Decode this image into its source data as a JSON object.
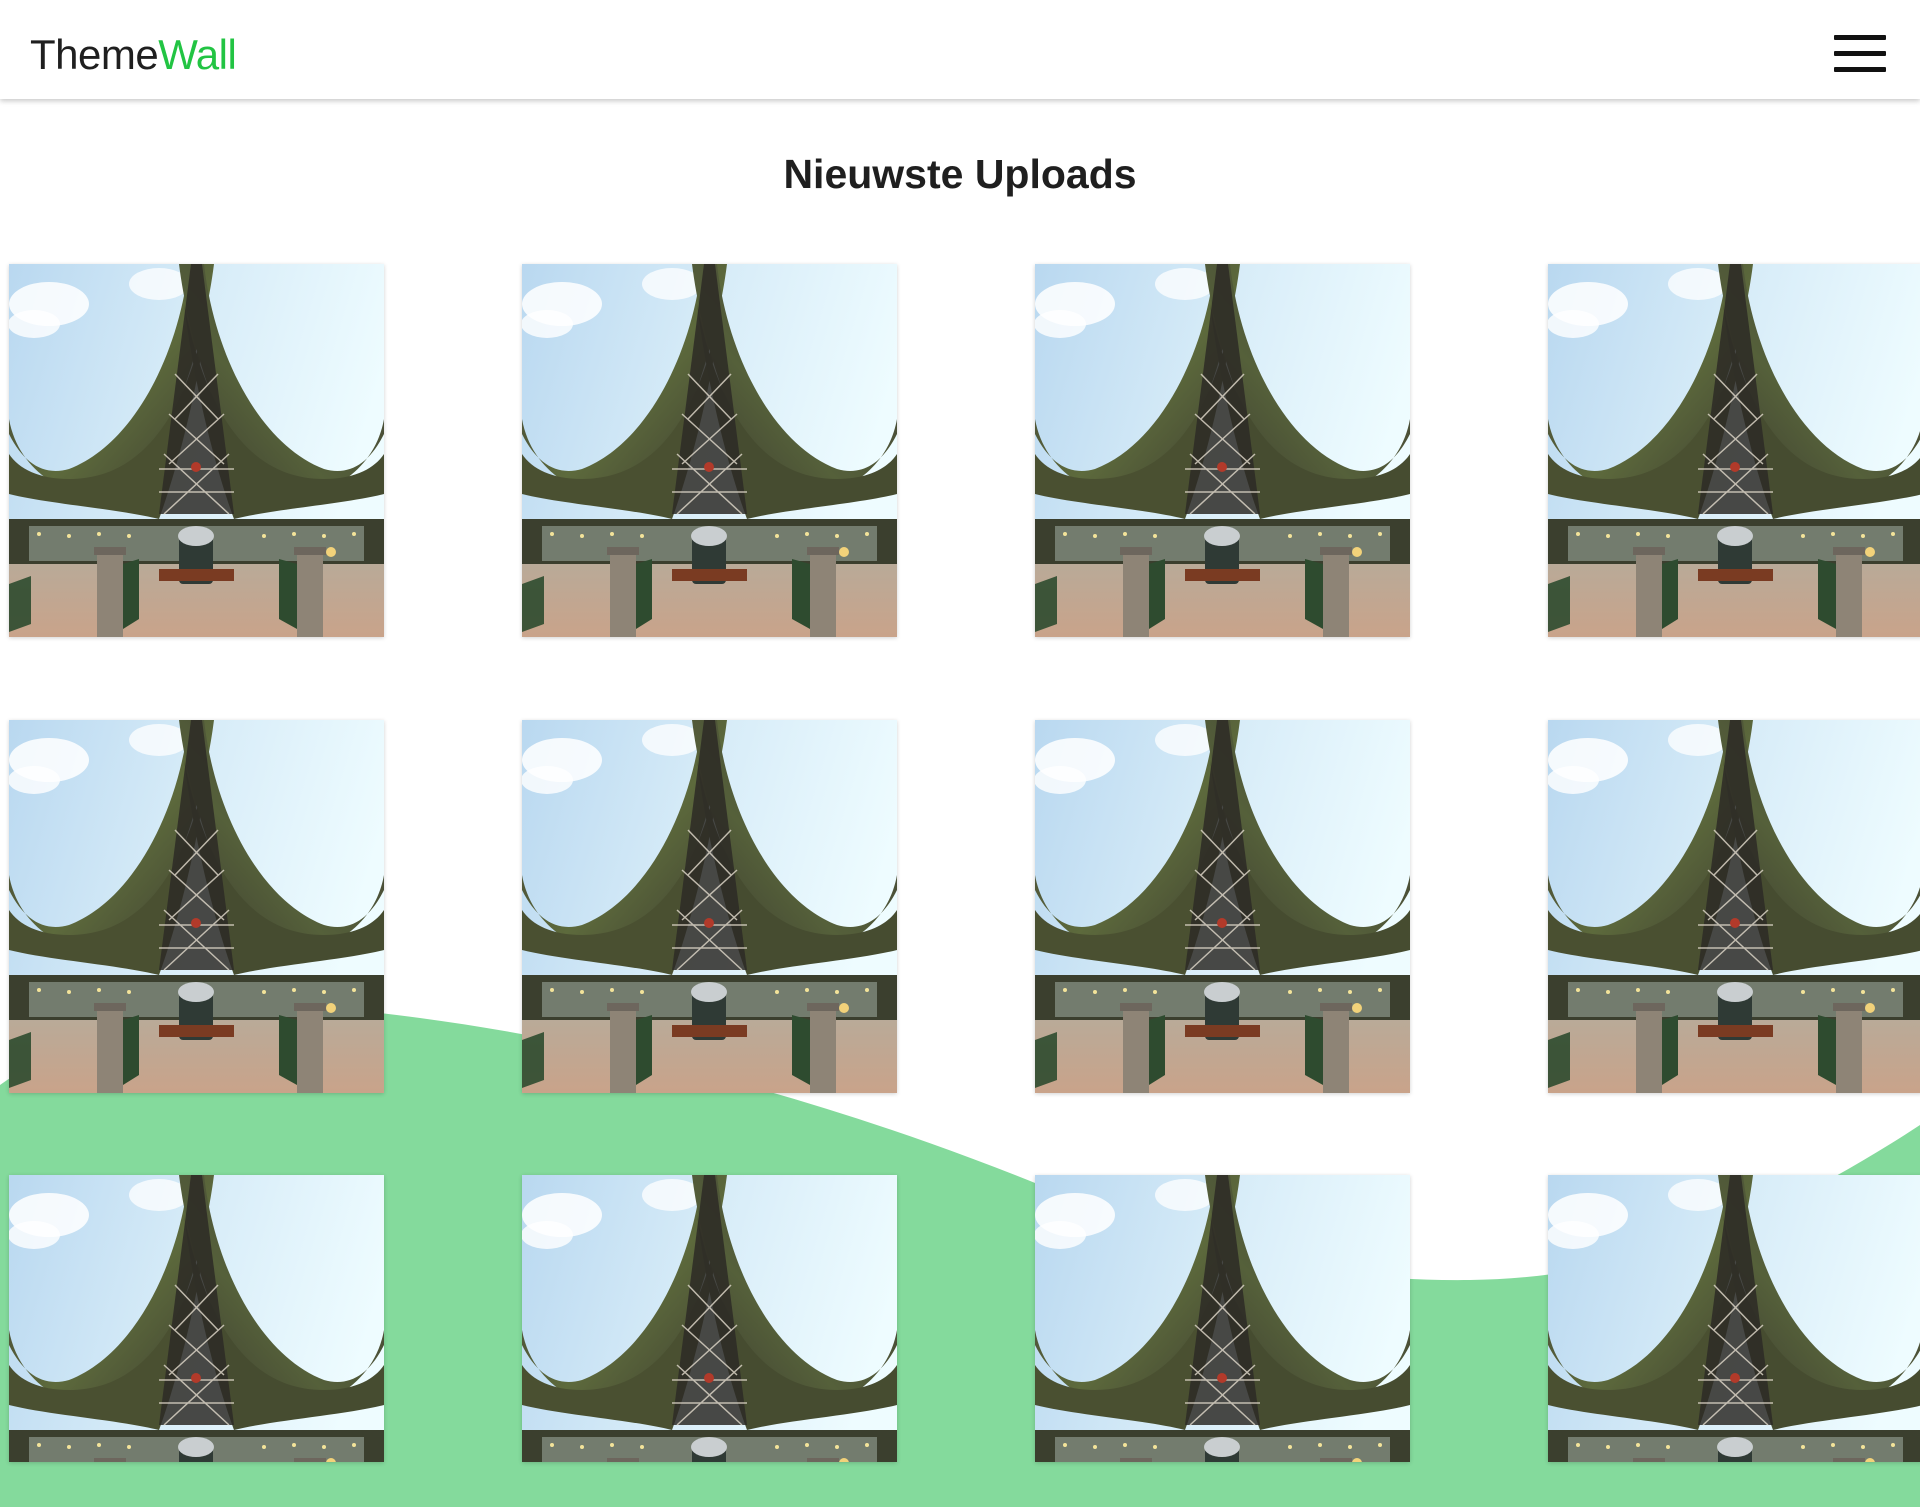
{
  "navbar": {
    "brand_primary": "Theme",
    "brand_accent": "Wall",
    "accent_color": "#22c443",
    "menu_icon": "hamburger-menu-icon"
  },
  "main": {
    "title": "Nieuwste Uploads",
    "gallery": {
      "item_count": 12,
      "image_subject": "fairy-tale style building with tall curved twin roof and central lattice tower",
      "visible_rows": 3,
      "items_per_row": 4
    }
  },
  "background": {
    "wave_color": "#84da9c"
  }
}
